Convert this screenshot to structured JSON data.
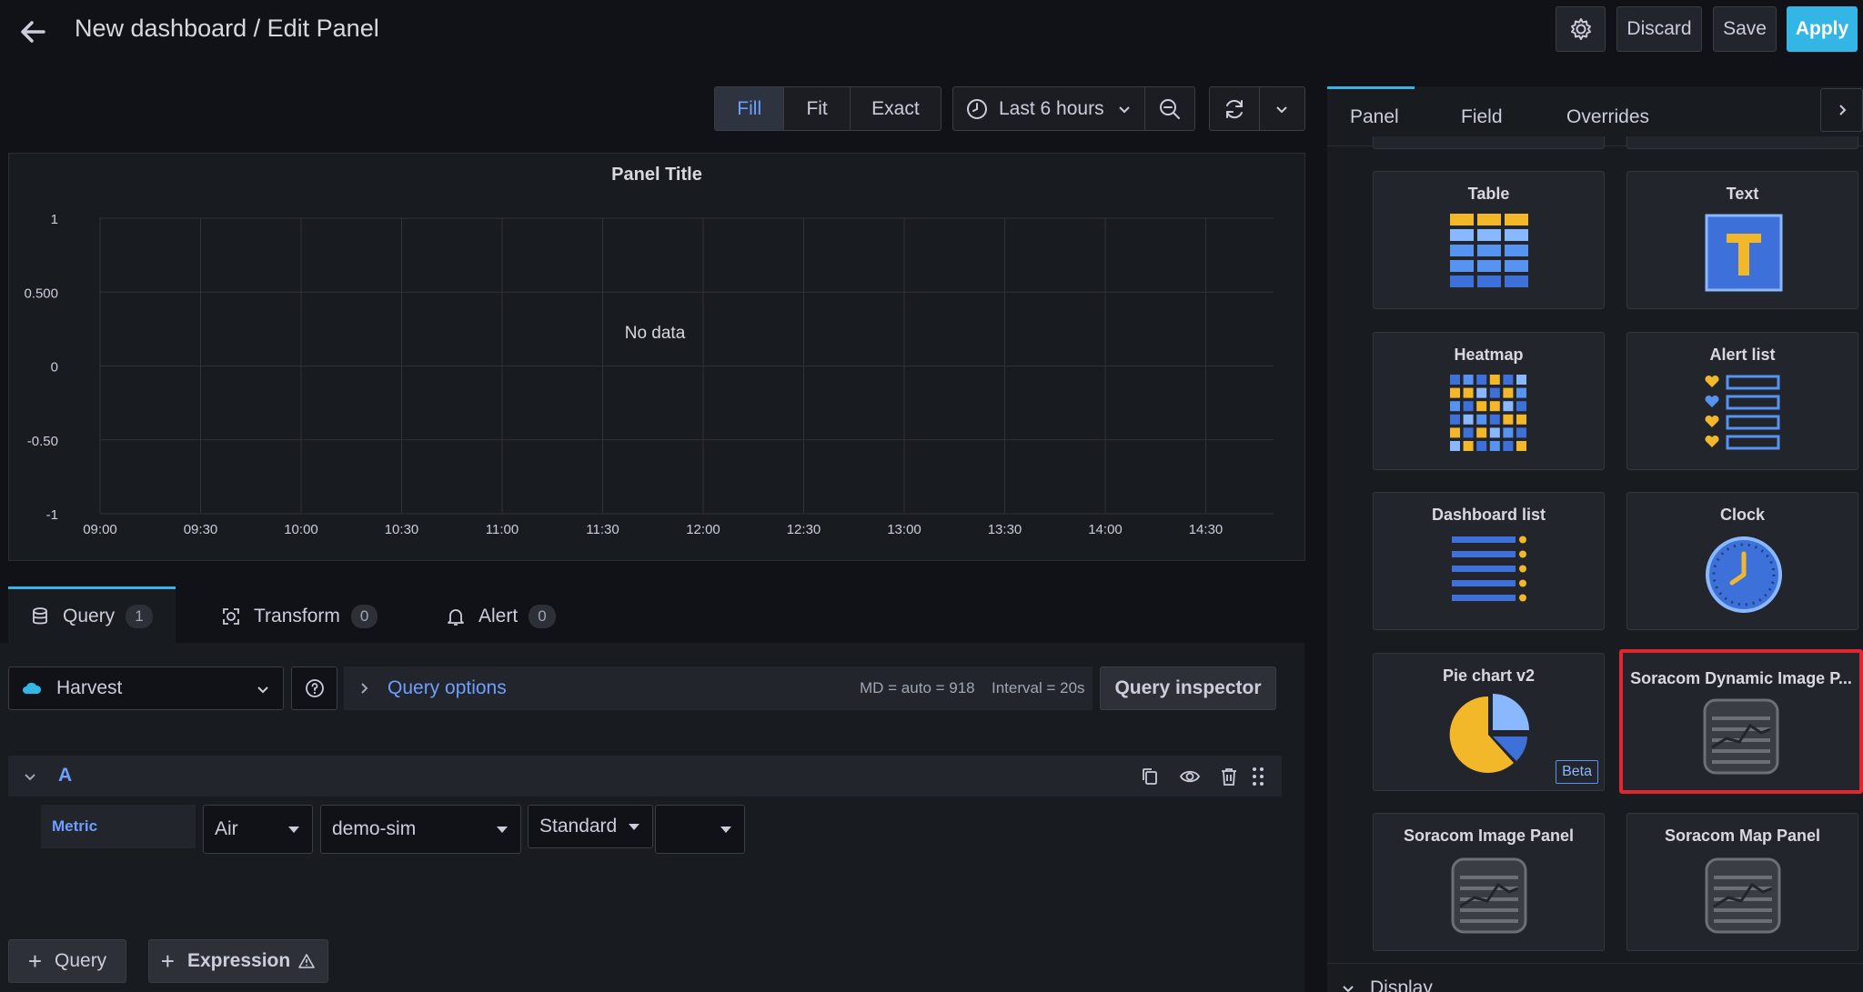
{
  "header": {
    "title": "New dashboard / Edit Panel",
    "discard_label": "Discard",
    "save_label": "Save",
    "apply_label": "Apply"
  },
  "toolbar": {
    "fill_label": "Fill",
    "fit_label": "Fit",
    "exact_label": "Exact",
    "time_range": "Last 6 hours"
  },
  "panel": {
    "title": "Panel Title",
    "empty_text": "No data"
  },
  "chart_data": {
    "type": "line",
    "title": "Panel Title",
    "x": [
      "09:00",
      "09:30",
      "10:00",
      "10:30",
      "11:00",
      "11:30",
      "12:00",
      "12:30",
      "13:00",
      "13:30",
      "14:00",
      "14:30"
    ],
    "y_ticks": [
      "1",
      "0.500",
      "0",
      "-0.50",
      "-1"
    ],
    "ylim": [
      -1,
      1
    ],
    "series": [],
    "annotation": "No data",
    "grid": true
  },
  "query_tabs": [
    {
      "label": "Query",
      "count": "1"
    },
    {
      "label": "Transform",
      "count": "0"
    },
    {
      "label": "Alert",
      "count": "0"
    }
  ],
  "query": {
    "datasource": "Harvest",
    "options_label": "Query options",
    "md_info": "MD = auto = 918",
    "interval_info": "Interval = 20s",
    "inspector_label": "Query inspector",
    "row_label": "A",
    "metric_label": "Metric",
    "metric_type": "Air",
    "sim_name": "demo-sim",
    "plan": "Standard",
    "extra": "",
    "add_query_label": "Query",
    "add_expression_label": "Expression"
  },
  "right_tabs": [
    "Panel",
    "Field",
    "Overrides"
  ],
  "visualizations": [
    {
      "label": "Table"
    },
    {
      "label": "Text"
    },
    {
      "label": "Heatmap"
    },
    {
      "label": "Alert list"
    },
    {
      "label": "Dashboard list"
    },
    {
      "label": "Clock"
    },
    {
      "label": "Pie chart v2",
      "badge": "Beta"
    },
    {
      "label": "Soracom Dynamic Image P..."
    },
    {
      "label": "Soracom Image Panel"
    },
    {
      "label": "Soracom Map Panel"
    }
  ],
  "section": {
    "display_label": "Display"
  },
  "colors": {
    "accent": "#33b5e5",
    "selected_border": "#e0262f",
    "link": "#6e9fff",
    "yellow": "#f2b829",
    "blue": "#5794f2"
  }
}
